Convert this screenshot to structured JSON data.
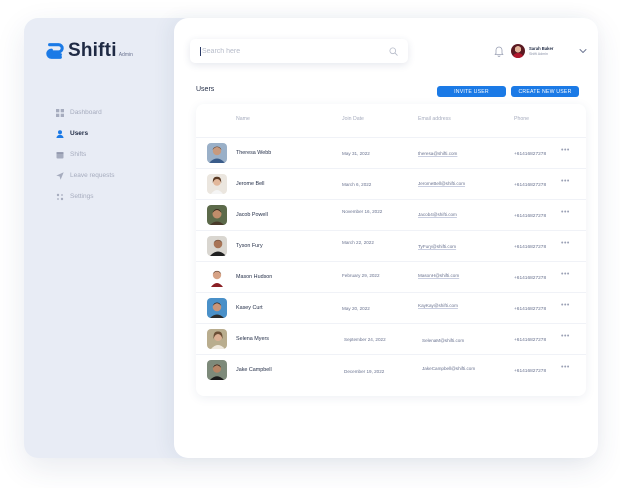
{
  "app": {
    "logo_text": "Shifti",
    "logo_sub": "Admin"
  },
  "sidebar": {
    "items": [
      {
        "label": "Dashboard",
        "icon": "grid-icon",
        "active": false
      },
      {
        "label": "Users",
        "icon": "user-icon",
        "active": true
      },
      {
        "label": "Shifts",
        "icon": "calendar-icon",
        "active": false
      },
      {
        "label": "Leave requests",
        "icon": "send-icon",
        "active": false
      },
      {
        "label": "Settings",
        "icon": "sliders-icon",
        "active": false
      }
    ]
  },
  "header": {
    "search_placeholder": "Search here",
    "user_name": "Sarah Baker",
    "user_role": "Shifti Admin"
  },
  "users": {
    "title": "Users",
    "invite_label": "INVITE USER",
    "create_label": "CREATE NEW USER",
    "columns": [
      "Name",
      "Join Date",
      "Email  address",
      "Phone"
    ],
    "rows": [
      {
        "name": "Theresa Webb",
        "date": "May 31, 2022",
        "email": "theresa@shifti.com",
        "phone": "+61416827278"
      },
      {
        "name": "Jerome Bell",
        "date": "March 6, 2022",
        "email": "JeromeBell@shifti.com",
        "phone": "+61416827278"
      },
      {
        "name": "Jacob Powell",
        "date": "November 16, 2022",
        "email": "Jacob4@shifti.com",
        "phone": "+61416827278"
      },
      {
        "name": "Tyson Fury",
        "date": "March 22, 2022",
        "email": "TyFury@shifti.com",
        "phone": "+61416827278"
      },
      {
        "name": "Mason Hudson",
        "date": "February 29, 2022",
        "email": "MasonH@shifti.com",
        "phone": "+61416827278"
      },
      {
        "name": "Kasey Curt",
        "date": "May 20, 2022",
        "email": "KayKay@shifti.com",
        "phone": "+61416827278"
      },
      {
        "name": "Selena Myers",
        "date": "September 24, 2022",
        "email": "SelenaM@shifti.com",
        "phone": "+61416827278"
      },
      {
        "name": "Jake Campbell",
        "date": "December 19, 2022",
        "email": "JakeCampbell@shifti.com",
        "phone": "+61416827278"
      }
    ],
    "more_label": "•••"
  },
  "colors": {
    "accent": "#1b7ae6",
    "brand": "#1b7ae6",
    "sidebar_bg": "#e8ecf5"
  }
}
